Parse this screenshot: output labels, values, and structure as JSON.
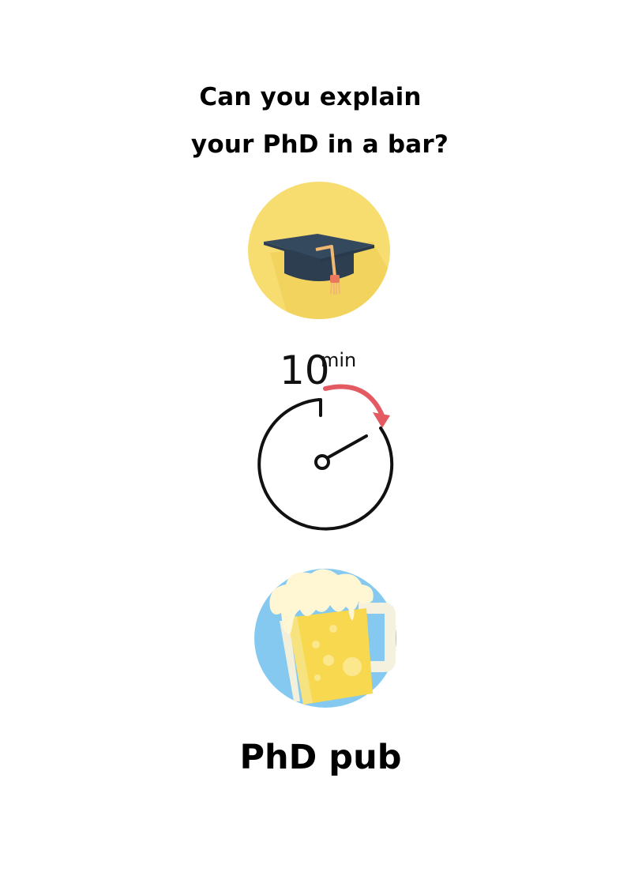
{
  "poster": {
    "headline_line1": "Can you explain",
    "headline_line2": "your PhD in a bar?",
    "timer_number": "10",
    "timer_unit": "min",
    "event_title": "PhD pub"
  },
  "icons": {
    "graduation": "graduation-cap-icon",
    "timer": "stopwatch-icon",
    "beer": "beer-mug-icon"
  },
  "colors": {
    "grad_circle": "#F7DC6F",
    "grad_circle_shadow": "#F1D360",
    "cap": "#34495E",
    "tassel": "#F0B870",
    "timer_arrow": "#E45A62",
    "beer_circle": "#85C9F0",
    "beer": "#F8D84E",
    "foam": "#FFF6D4"
  }
}
